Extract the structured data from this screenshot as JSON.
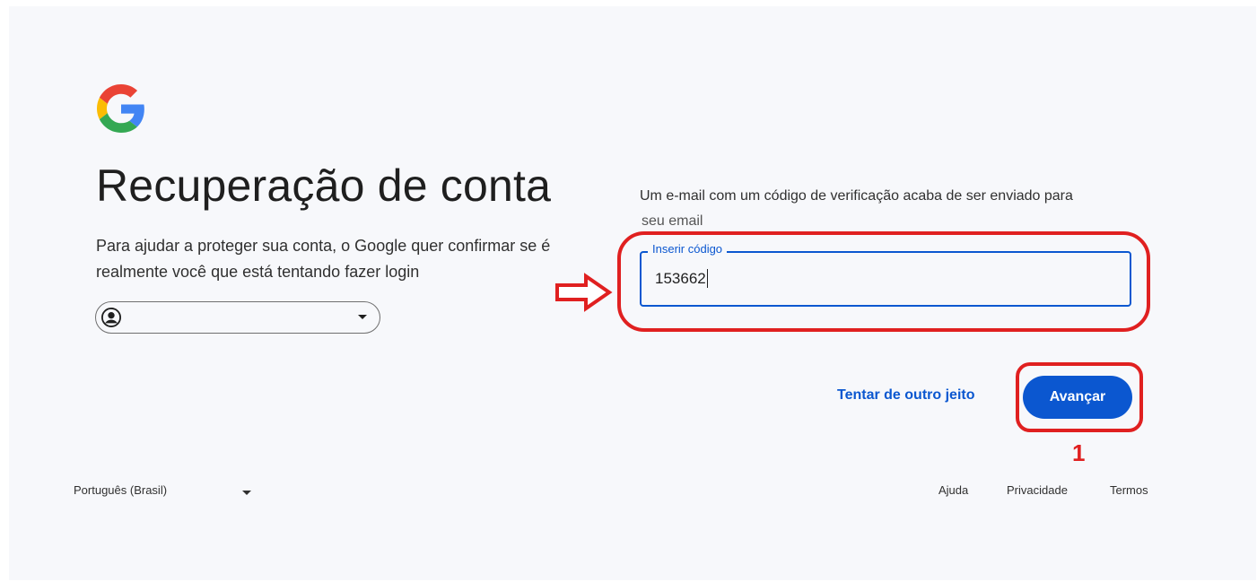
{
  "header": {
    "logo_icon": "google-g-icon",
    "title": "Recuperação de conta",
    "subtitle": "Para ajudar a proteger sua conta, o Google quer confirmar se é realmente você que está tentando fazer login"
  },
  "account_chip": {
    "avatar_icon": "account-circle-icon",
    "caret_icon": "caret-down-icon"
  },
  "verification": {
    "info": "Um e-mail com um código de verificação acaba de ser enviado para",
    "info_line2": "seu email",
    "field_label": "Inserir código",
    "field_value": "153662"
  },
  "actions": {
    "try_other": "Tentar de outro jeito",
    "next": "Avançar"
  },
  "annotations": {
    "step_number": "1",
    "color": "#e02020"
  },
  "footer": {
    "language": "Português (Brasil)",
    "help": "Ajuda",
    "privacy": "Privacidade",
    "terms": "Termos"
  },
  "colors": {
    "accent": "#0b57d0",
    "background": "#f7f8fb"
  }
}
